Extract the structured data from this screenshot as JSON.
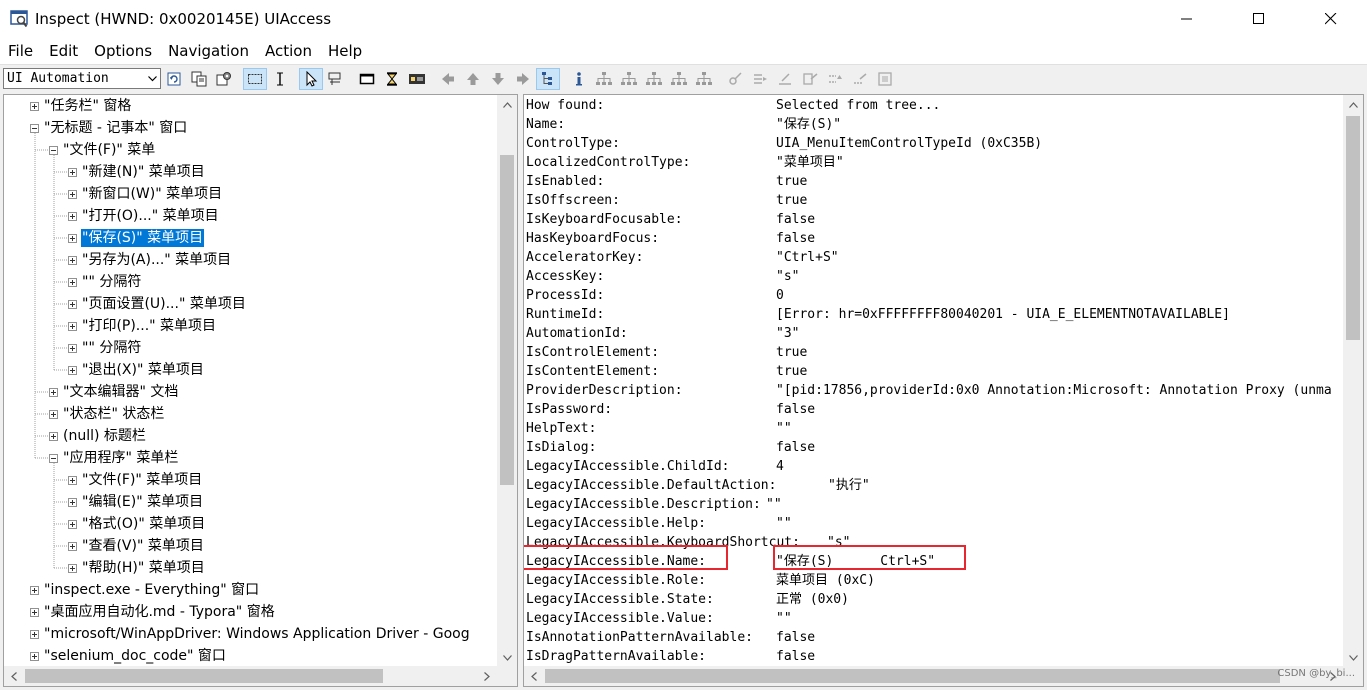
{
  "window": {
    "title": "Inspect  (HWND: 0x0020145E) UIAccess",
    "minimize_icon": "minimize-icon",
    "maximize_icon": "maximize-icon",
    "close_icon": "close-icon"
  },
  "menu": [
    "File",
    "Edit",
    "Options",
    "Navigation",
    "Action",
    "Help"
  ],
  "toolbar": {
    "mode_select": "UI Automation"
  },
  "tree": {
    "items": [
      {
        "text": "\"任务栏\" 窗格",
        "level": 1,
        "expander": "plus"
      },
      {
        "text": "\"无标题 - 记事本\" 窗口",
        "level": 1,
        "expander": "minus"
      },
      {
        "text": "\"文件(F)\" 菜单",
        "level": 2,
        "expander": "minus"
      },
      {
        "text": "\"新建(N)\" 菜单项目",
        "level": 3,
        "expander": "plus"
      },
      {
        "text": "\"新窗口(W)\" 菜单项目",
        "level": 3,
        "expander": "plus"
      },
      {
        "text": "\"打开(O)...\" 菜单项目",
        "level": 3,
        "expander": "plus"
      },
      {
        "text": "\"保存(S)\" 菜单项目",
        "level": 3,
        "expander": "plus",
        "selected": true
      },
      {
        "text": "\"另存为(A)...\" 菜单项目",
        "level": 3,
        "expander": "plus"
      },
      {
        "text": "\"\" 分隔符",
        "level": 3,
        "expander": "plus"
      },
      {
        "text": "\"页面设置(U)...\" 菜单项目",
        "level": 3,
        "expander": "plus"
      },
      {
        "text": "\"打印(P)...\" 菜单项目",
        "level": 3,
        "expander": "plus"
      },
      {
        "text": "\"\" 分隔符",
        "level": 3,
        "expander": "plus"
      },
      {
        "text": "\"退出(X)\" 菜单项目",
        "level": 3,
        "expander": "plus"
      },
      {
        "text": "\"文本编辑器\" 文档",
        "level": 2,
        "expander": "plus"
      },
      {
        "text": "\"状态栏\" 状态栏",
        "level": 2,
        "expander": "plus"
      },
      {
        "text": "(null) 标题栏",
        "level": 2,
        "expander": "plus"
      },
      {
        "text": "\"应用程序\" 菜单栏",
        "level": 2,
        "expander": "minus"
      },
      {
        "text": "\"文件(F)\" 菜单项目",
        "level": 3,
        "expander": "plus"
      },
      {
        "text": "\"编辑(E)\" 菜单项目",
        "level": 3,
        "expander": "plus"
      },
      {
        "text": "\"格式(O)\" 菜单项目",
        "level": 3,
        "expander": "plus"
      },
      {
        "text": "\"查看(V)\" 菜单项目",
        "level": 3,
        "expander": "plus"
      },
      {
        "text": "\"帮助(H)\" 菜单项目",
        "level": 3,
        "expander": "plus"
      },
      {
        "text": "\"inspect.exe  - Everything\" 窗口",
        "level": 1,
        "expander": "plus"
      },
      {
        "text": "\"桌面应用自动化.md - Typora\" 窗格",
        "level": 1,
        "expander": "plus"
      },
      {
        "text": "\"microsoft/WinAppDriver: Windows Application Driver - Goog",
        "level": 1,
        "expander": "plus"
      },
      {
        "text": "\"selenium_doc_code\" 窗口",
        "level": 1,
        "expander": "plus"
      }
    ]
  },
  "properties": [
    {
      "key": "How found:",
      "value": "Selected from tree..."
    },
    {
      "key": "Name:",
      "value": "\"保存(S)\""
    },
    {
      "key": "ControlType:",
      "value": "UIA_MenuItemControlTypeId (0xC35B)"
    },
    {
      "key": "LocalizedControlType:",
      "value": "\"菜单项目\""
    },
    {
      "key": "IsEnabled:",
      "value": "true"
    },
    {
      "key": "IsOffscreen:",
      "value": "true"
    },
    {
      "key": "IsKeyboardFocusable:",
      "value": "false"
    },
    {
      "key": "HasKeyboardFocus:",
      "value": "false"
    },
    {
      "key": "AcceleratorKey:",
      "value": "\"Ctrl+S\""
    },
    {
      "key": "AccessKey:",
      "value": "\"s\""
    },
    {
      "key": "ProcessId:",
      "value": "0"
    },
    {
      "key": "RuntimeId:",
      "value": "[Error: hr=0xFFFFFFFF80040201 - UIA_E_ELEMENTNOTAVAILABLE]"
    },
    {
      "key": "AutomationId:",
      "value": "\"3\""
    },
    {
      "key": "IsControlElement:",
      "value": "true"
    },
    {
      "key": "IsContentElement:",
      "value": "true"
    },
    {
      "key": "ProviderDescription:",
      "value": "\"[pid:17856,providerId:0x0 Annotation:Microsoft: Annotation Proxy (unma"
    },
    {
      "key": "IsPassword:",
      "value": "false"
    },
    {
      "key": "HelpText:",
      "value": "\"\""
    },
    {
      "key": "IsDialog:",
      "value": "false"
    },
    {
      "key": "LegacyIAccessible.ChildId:",
      "value": "4"
    },
    {
      "key": "LegacyIAccessible.DefaultAction:",
      "value": "\"执行\"",
      "offset": "long"
    },
    {
      "key": "LegacyIAccessible.Description:",
      "value": "\"\"",
      "offset": "desc"
    },
    {
      "key": "LegacyIAccessible.Help:",
      "value": "\"\""
    },
    {
      "key": "LegacyIAccessible.KeyboardShortcut:",
      "value": "\"s\"",
      "offset": "kbd"
    },
    {
      "key": "LegacyIAccessible.Name:",
      "value": "\"保存(S)      Ctrl+S\"",
      "highlight": true
    },
    {
      "key": "LegacyIAccessible.Role:",
      "value": "菜单项目 (0xC)"
    },
    {
      "key": "LegacyIAccessible.State:",
      "value": "正常 (0x0)"
    },
    {
      "key": "LegacyIAccessible.Value:",
      "value": "\"\""
    },
    {
      "key": "IsAnnotationPatternAvailable:",
      "value": "false"
    },
    {
      "key": "IsDragPatternAvailable:",
      "value": "false"
    }
  ],
  "watermark": "CSDN @by_bi...",
  "colors": {
    "selection": "#0078d7",
    "highlight_box": "#e8262f"
  }
}
